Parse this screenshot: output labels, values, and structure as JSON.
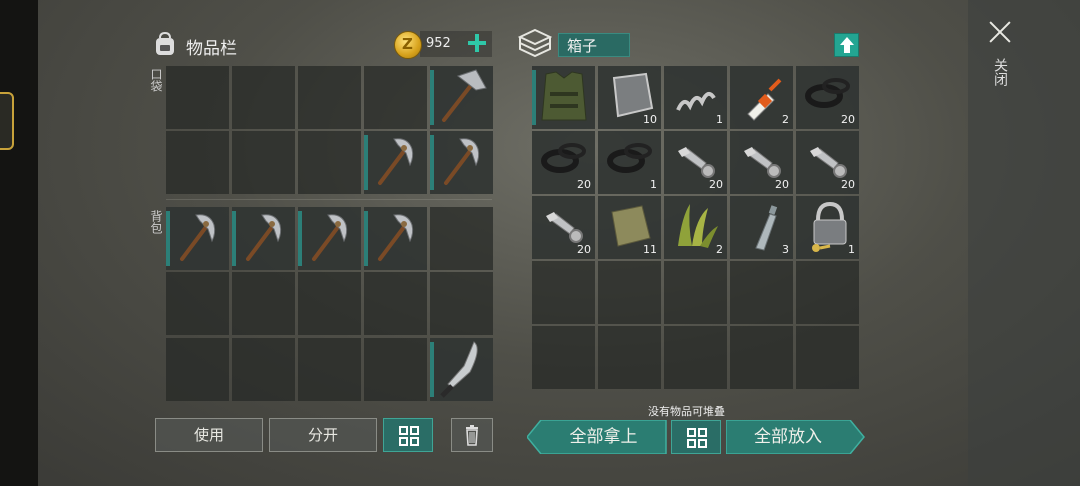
{
  "inventory": {
    "title": "物品栏",
    "coins": "952",
    "pocket_label": "口袋",
    "backpack_label": "背包"
  },
  "container": {
    "name": "箱子",
    "status": "没有物品可堆叠"
  },
  "close_label": "关闭",
  "buttons": {
    "use": "使用",
    "split": "分开",
    "take_all": "全部拿上",
    "put_all": "全部放入"
  },
  "left_slots": [
    {
      "item": "",
      "qty": ""
    },
    {
      "item": "",
      "qty": ""
    },
    {
      "item": "",
      "qty": ""
    },
    {
      "item": "",
      "qty": ""
    },
    {
      "item": "hammer",
      "qty": ""
    },
    {
      "item": "",
      "qty": ""
    },
    {
      "item": "",
      "qty": ""
    },
    {
      "item": "",
      "qty": ""
    },
    {
      "item": "pickaxe",
      "qty": ""
    },
    {
      "item": "pickaxe",
      "qty": ""
    },
    {
      "item": "pickaxe",
      "qty": ""
    },
    {
      "item": "pickaxe",
      "qty": ""
    },
    {
      "item": "pickaxe",
      "qty": ""
    },
    {
      "item": "pickaxe",
      "qty": ""
    },
    {
      "item": "",
      "qty": ""
    },
    {
      "item": "",
      "qty": ""
    },
    {
      "item": "",
      "qty": ""
    },
    {
      "item": "",
      "qty": ""
    },
    {
      "item": "",
      "qty": ""
    },
    {
      "item": "",
      "qty": ""
    },
    {
      "item": "",
      "qty": ""
    },
    {
      "item": "",
      "qty": ""
    },
    {
      "item": "",
      "qty": ""
    },
    {
      "item": "",
      "qty": ""
    },
    {
      "item": "machete",
      "qty": ""
    }
  ],
  "right_slots": [
    {
      "item": "vest",
      "qty": ""
    },
    {
      "item": "metal-plate",
      "qty": "10"
    },
    {
      "item": "spring",
      "qty": "1"
    },
    {
      "item": "glue",
      "qty": "2"
    },
    {
      "item": "rubber-ring",
      "qty": "20"
    },
    {
      "item": "rubber-ring",
      "qty": "20"
    },
    {
      "item": "rubber-ring",
      "qty": "1"
    },
    {
      "item": "bolt",
      "qty": "20"
    },
    {
      "item": "bolt",
      "qty": "20"
    },
    {
      "item": "bolt",
      "qty": "20"
    },
    {
      "item": "bolt",
      "qty": "20"
    },
    {
      "item": "cloth",
      "qty": "11"
    },
    {
      "item": "plant-fiber",
      "qty": "2"
    },
    {
      "item": "bottle",
      "qty": "3"
    },
    {
      "item": "padlock",
      "qty": "1"
    },
    {
      "item": "",
      "qty": ""
    },
    {
      "item": "",
      "qty": ""
    },
    {
      "item": "",
      "qty": ""
    },
    {
      "item": "",
      "qty": ""
    },
    {
      "item": "",
      "qty": ""
    },
    {
      "item": "",
      "qty": ""
    },
    {
      "item": "",
      "qty": ""
    },
    {
      "item": "",
      "qty": ""
    },
    {
      "item": "",
      "qty": ""
    },
    {
      "item": "",
      "qty": ""
    }
  ]
}
